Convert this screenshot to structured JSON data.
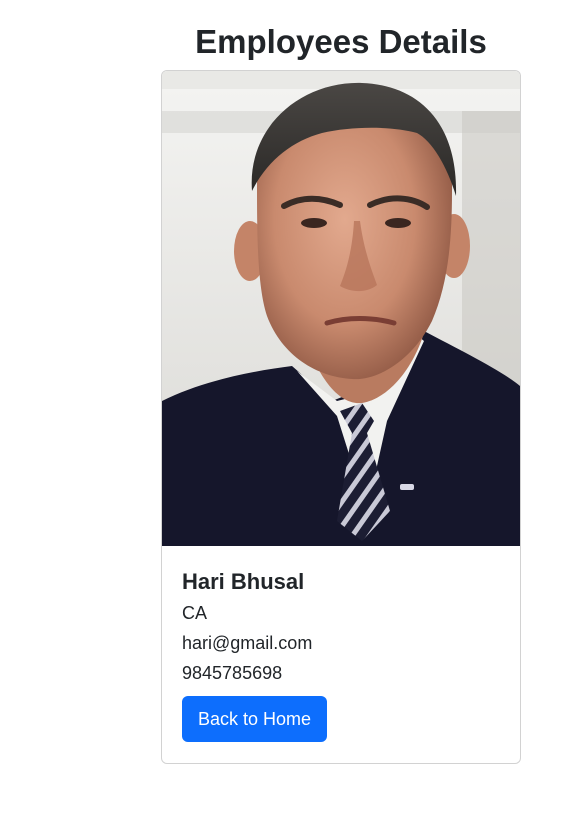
{
  "page": {
    "title": "Employees Details"
  },
  "employee": {
    "name": "Hari Bhusal",
    "role": "CA",
    "email": "hari@gmail.com",
    "phone": "9845785698"
  },
  "actions": {
    "back_label": "Back to Home"
  },
  "colors": {
    "primary": "#0d6efd",
    "text": "#212529",
    "suit": "#15162b"
  }
}
